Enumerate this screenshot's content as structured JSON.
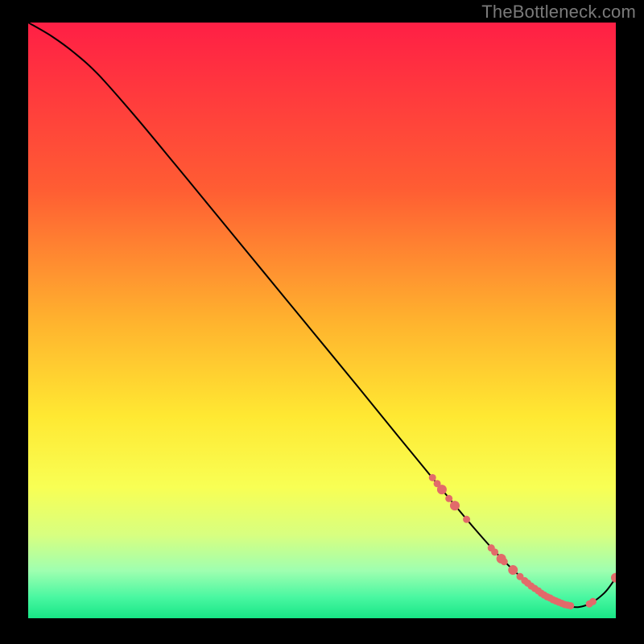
{
  "watermark": "TheBottleneck.com",
  "chart_data": {
    "type": "line",
    "title": "",
    "xlabel": "",
    "ylabel": "",
    "xlim": [
      0,
      100
    ],
    "ylim": [
      0,
      100
    ],
    "gradient_stops": [
      {
        "offset": 0.0,
        "color": "#ff1f45"
      },
      {
        "offset": 0.28,
        "color": "#ff5d33"
      },
      {
        "offset": 0.5,
        "color": "#ffb22e"
      },
      {
        "offset": 0.66,
        "color": "#ffe832"
      },
      {
        "offset": 0.78,
        "color": "#f8ff54"
      },
      {
        "offset": 0.86,
        "color": "#d8ff80"
      },
      {
        "offset": 0.92,
        "color": "#9fffb0"
      },
      {
        "offset": 0.965,
        "color": "#49f7a1"
      },
      {
        "offset": 1.0,
        "color": "#17e686"
      }
    ],
    "series": [
      {
        "name": "bottleneck-curve",
        "color": "#000000",
        "x": [
          0,
          4,
          8,
          12,
          18,
          25,
          32,
          40,
          48,
          56,
          63,
          68,
          72,
          76,
          80,
          84,
          88,
          92,
          95,
          98,
          100
        ],
        "y": [
          100,
          97.7,
          94.8,
          91.2,
          84.5,
          76.2,
          67.8,
          58.2,
          48.6,
          39.0,
          30.5,
          24.5,
          19.7,
          15.0,
          10.6,
          6.8,
          3.8,
          2.0,
          2.2,
          4.2,
          6.8
        ]
      }
    ],
    "markers": {
      "name": "highlight-dots",
      "color": "#e26a6a",
      "radius_small": 4.5,
      "radius_large": 6.0,
      "points": [
        {
          "x": 68.8,
          "y": 23.6,
          "r": "small"
        },
        {
          "x": 69.6,
          "y": 22.6,
          "r": "small"
        },
        {
          "x": 70.4,
          "y": 21.6,
          "r": "large"
        },
        {
          "x": 71.6,
          "y": 20.1,
          "r": "small"
        },
        {
          "x": 72.6,
          "y": 18.9,
          "r": "large"
        },
        {
          "x": 74.6,
          "y": 16.6,
          "r": "small"
        },
        {
          "x": 78.8,
          "y": 11.8,
          "r": "small"
        },
        {
          "x": 79.4,
          "y": 11.1,
          "r": "small"
        },
        {
          "x": 80.5,
          "y": 10.0,
          "r": "large"
        },
        {
          "x": 81.0,
          "y": 9.5,
          "r": "small"
        },
        {
          "x": 82.5,
          "y": 8.1,
          "r": "large"
        },
        {
          "x": 83.7,
          "y": 7.0,
          "r": "small"
        },
        {
          "x": 84.5,
          "y": 6.3,
          "r": "small"
        },
        {
          "x": 85.0,
          "y": 5.9,
          "r": "small"
        },
        {
          "x": 85.6,
          "y": 5.4,
          "r": "small"
        },
        {
          "x": 86.2,
          "y": 5.0,
          "r": "small"
        },
        {
          "x": 86.8,
          "y": 4.6,
          "r": "small"
        },
        {
          "x": 87.3,
          "y": 4.2,
          "r": "small"
        },
        {
          "x": 87.8,
          "y": 3.9,
          "r": "small"
        },
        {
          "x": 88.3,
          "y": 3.6,
          "r": "small"
        },
        {
          "x": 88.8,
          "y": 3.4,
          "r": "small"
        },
        {
          "x": 89.3,
          "y": 3.1,
          "r": "small"
        },
        {
          "x": 89.8,
          "y": 2.9,
          "r": "small"
        },
        {
          "x": 90.3,
          "y": 2.7,
          "r": "small"
        },
        {
          "x": 90.8,
          "y": 2.5,
          "r": "small"
        },
        {
          "x": 91.3,
          "y": 2.3,
          "r": "small"
        },
        {
          "x": 91.8,
          "y": 2.2,
          "r": "small"
        },
        {
          "x": 92.3,
          "y": 2.1,
          "r": "small"
        },
        {
          "x": 95.5,
          "y": 2.4,
          "r": "small"
        },
        {
          "x": 96.1,
          "y": 2.8,
          "r": "small"
        },
        {
          "x": 100.0,
          "y": 6.8,
          "r": "large"
        }
      ]
    }
  }
}
